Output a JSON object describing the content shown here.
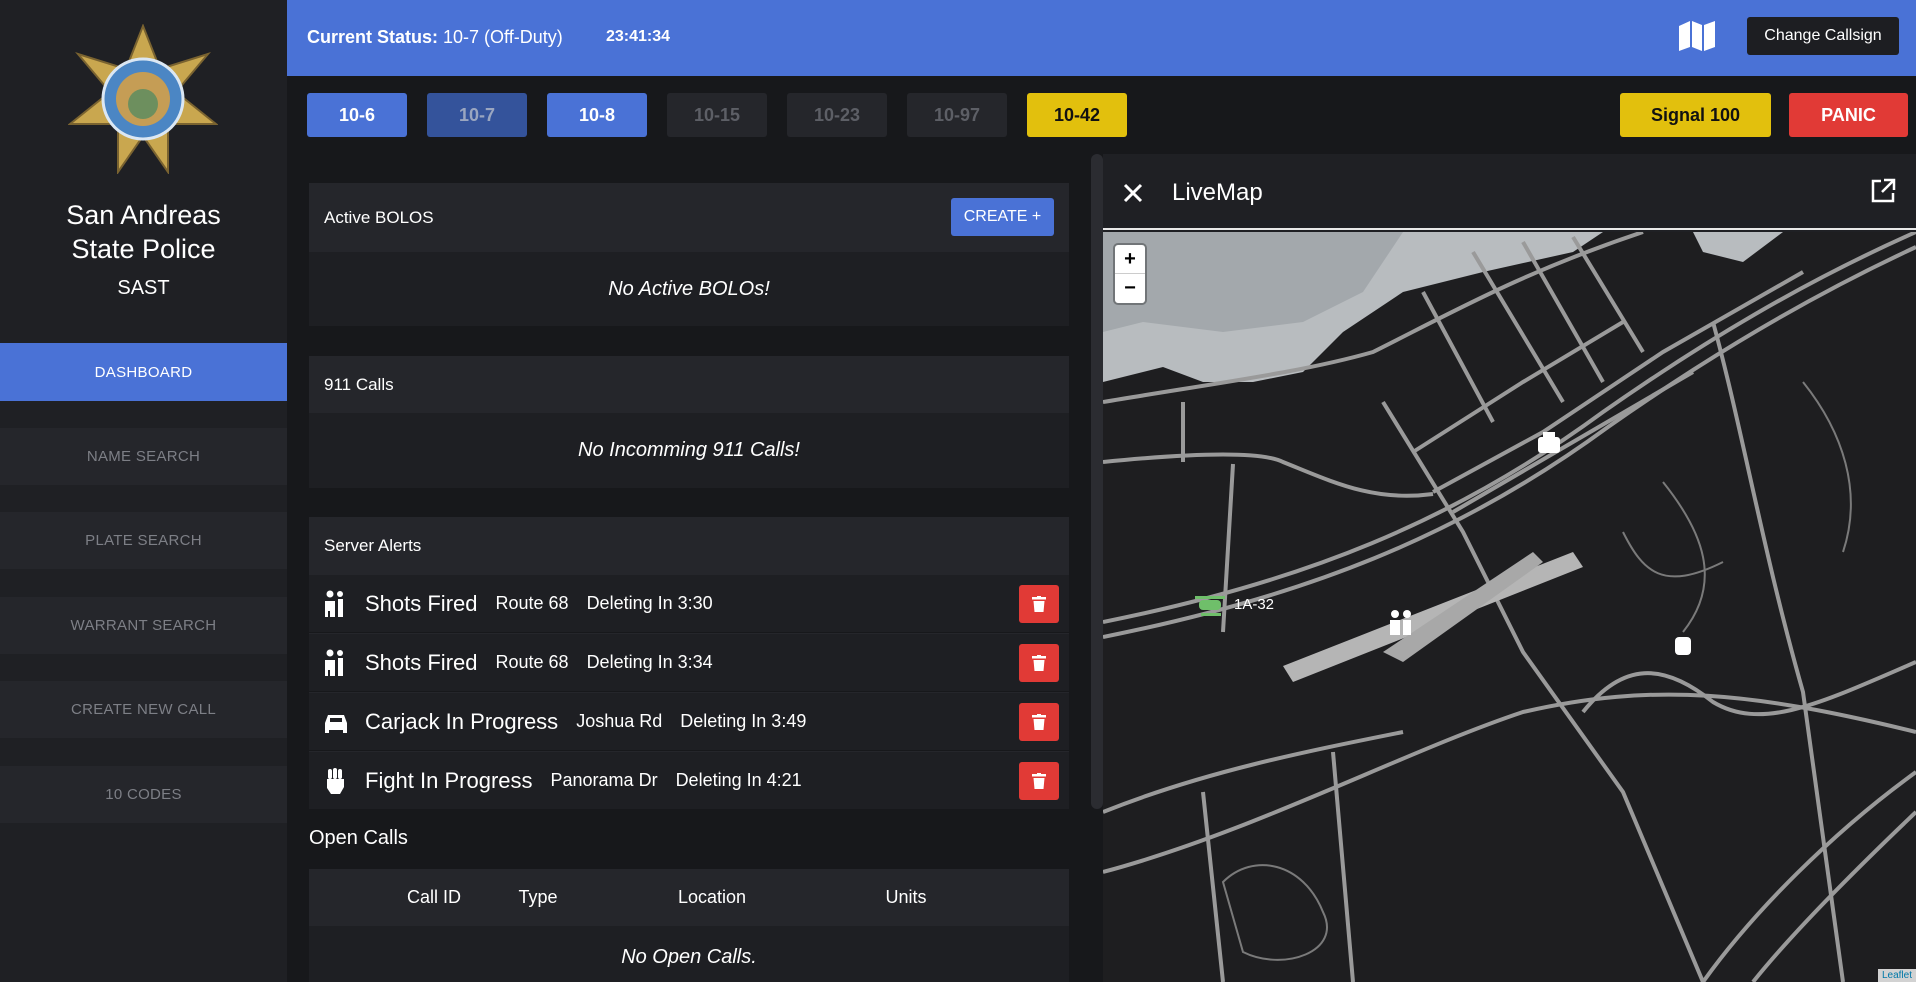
{
  "sidebar": {
    "org_line1": "San Andreas",
    "org_line2": "State Police",
    "org_short": "SAST",
    "logo_text": "SAN ANDREAS STATE POLICE",
    "items": [
      {
        "label": "DASHBOARD",
        "active": true
      },
      {
        "label": "NAME SEARCH"
      },
      {
        "label": "PLATE SEARCH"
      },
      {
        "label": "WARRANT SEARCH"
      },
      {
        "label": "CREATE NEW CALL"
      },
      {
        "label": "10 CODES"
      }
    ]
  },
  "header": {
    "status_label": "Current Status:",
    "status_value": "10-7 (Off-Duty)",
    "time": "23:41:34",
    "map_icon": "map-icon",
    "change_callsign": "Change Callsign"
  },
  "codes": [
    {
      "label": "10-6",
      "state": "active"
    },
    {
      "label": "10-7",
      "state": "current"
    },
    {
      "label": "10-8",
      "state": "active"
    },
    {
      "label": "10-15",
      "state": "disabled"
    },
    {
      "label": "10-23",
      "state": "disabled"
    },
    {
      "label": "10-97",
      "state": "disabled"
    },
    {
      "label": "10-42",
      "state": "warning"
    }
  ],
  "signal100": "Signal 100",
  "panic": "PANIC",
  "colors": {
    "accent": "#4a72d6",
    "warning": "#e2c00d",
    "danger": "#e13a36"
  },
  "bolos": {
    "title": "Active BOLOS",
    "create": "CREATE +",
    "empty": "No Active BOLOs!"
  },
  "calls911": {
    "title": "911 Calls",
    "empty": "No Incomming 911 Calls!"
  },
  "alerts": {
    "title": "Server Alerts",
    "items": [
      {
        "icon": "shots-fired-icon",
        "type": "Shots Fired",
        "location": "Route 68",
        "deleting": "Deleting In 3:30"
      },
      {
        "icon": "shots-fired-icon",
        "type": "Shots Fired",
        "location": "Route 68",
        "deleting": "Deleting In 3:34"
      },
      {
        "icon": "car-icon",
        "type": "Carjack In Progress",
        "location": "Joshua Rd",
        "deleting": "Deleting In 3:49"
      },
      {
        "icon": "fist-icon",
        "type": "Fight In Progress",
        "location": "Panorama Dr",
        "deleting": "Deleting In 4:21"
      }
    ]
  },
  "open_calls": {
    "title": "Open Calls",
    "columns": [
      "Call ID",
      "Type",
      "Location",
      "Units"
    ],
    "empty": "No Open Calls."
  },
  "livemap": {
    "title": "LiveMap",
    "zoom_in": "+",
    "zoom_out": "−",
    "unit_label": "1A-32",
    "attribution": "Leaflet"
  }
}
